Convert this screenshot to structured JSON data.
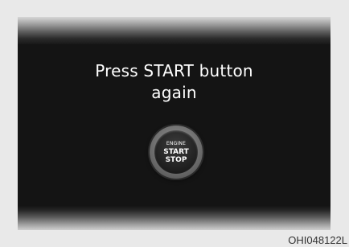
{
  "display": {
    "message_line1": "Press START button",
    "message_line2": "again"
  },
  "start_button": {
    "engine_label": "ENGINE",
    "start_label": "START",
    "stop_label": "STOP"
  },
  "figure_code": "OHI048122L",
  "colors": {
    "screen_background": "#141414",
    "text": "#ffffff",
    "frame": "#e9e9e9"
  }
}
